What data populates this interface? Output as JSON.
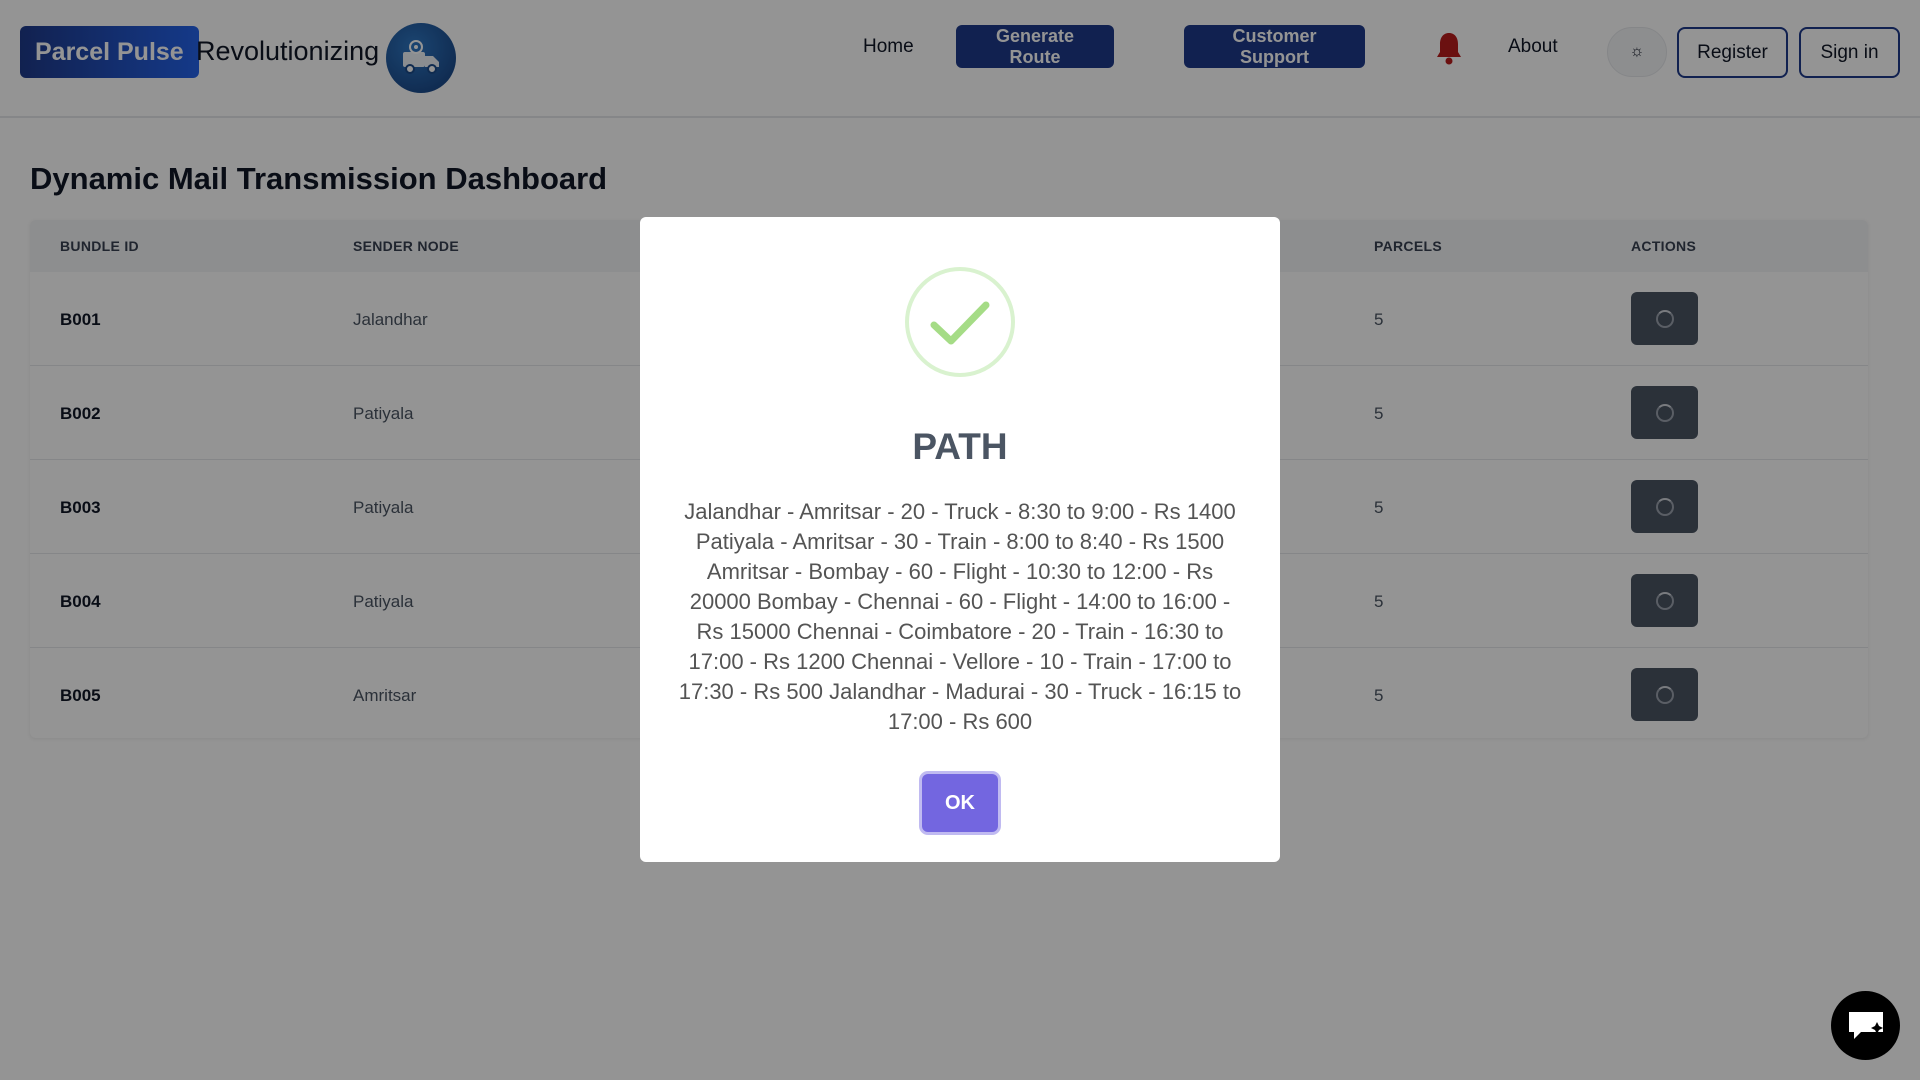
{
  "nav": {
    "brand": "Parcel Pulse",
    "tagline": "Revolutionizing",
    "links": {
      "home": "Home",
      "about": "About"
    },
    "buttons": {
      "generate": "Generate Route",
      "support": "Customer Support",
      "register": "Register",
      "signin": "Sign in"
    },
    "theme_icon": "☼"
  },
  "dashboard": {
    "title": "Dynamic Mail Transmission Dashboard",
    "headers": {
      "bundle_id": "BUNDLE ID",
      "sender": "SENDER NODE",
      "parcels": "PARCELS",
      "actions": "ACTIONS"
    },
    "rows": [
      {
        "id": "B001",
        "sender": "Jalandhar",
        "parcels": "5"
      },
      {
        "id": "B002",
        "sender": "Patiyala",
        "parcels": "5"
      },
      {
        "id": "B003",
        "sender": "Patiyala",
        "parcels": "5"
      },
      {
        "id": "B004",
        "sender": "Patiyala",
        "parcels": "5"
      },
      {
        "id": "B005",
        "sender": "Amritsar",
        "parcels": "5"
      }
    ]
  },
  "modal": {
    "title": "PATH",
    "text": "Jalandhar - Amritsar - 20 - Truck - 8:30 to 9:00 - Rs 1400 Patiyala - Amritsar - 30 - Train - 8:00 to 8:40 - Rs 1500 Amritsar - Bombay - 60 - Flight - 10:30 to 12:00 - Rs 20000 Bombay - Chennai - 60 - Flight - 14:00 to 16:00 - Rs 15000 Chennai - Coimbatore - 20 - Train - 16:30 to 17:00 - Rs 1200 Chennai - Vellore - 10 - Train - 17:00 to 17:30 - Rs 500 Jalandhar - Madurai - 30 - Truck - 16:15 to 17:00 - Rs 600",
    "ok_label": "OK"
  },
  "icons": {
    "logo": "delivery-truck-icon",
    "bell": "bell-icon",
    "theme": "sun-icon",
    "success": "checkmark-icon",
    "chat": "chat-icon",
    "action": "loading-icon"
  },
  "colors": {
    "brand_blue": "#1e3a8a",
    "bell_red": "#b91c1c",
    "ok_purple": "#7366e0",
    "success_green": "#a5dc86"
  }
}
